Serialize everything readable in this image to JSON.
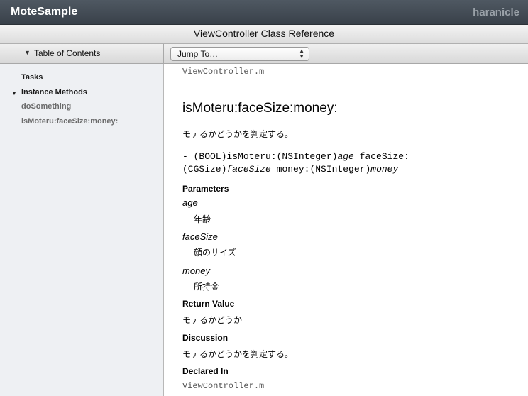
{
  "titlebar": {
    "app_name": "MoteSample",
    "company": "haranicle"
  },
  "classbar": {
    "title": "ViewController Class Reference"
  },
  "toolbar": {
    "toc_label": "Table of Contents",
    "jump_label": "Jump To…"
  },
  "sidebar": {
    "items": [
      {
        "label": "Tasks"
      },
      {
        "label": "Instance Methods"
      },
      {
        "label": "doSomething"
      },
      {
        "label": "isMoteru:faceSize:money:"
      }
    ]
  },
  "content": {
    "file_name": "ViewController.m",
    "method_title": "isMoteru:faceSize:money:",
    "abstract": "モテるかどうかを判定する。",
    "declaration": {
      "line1_a": "- (BOOL)isMoteru:(NSInteger)",
      "line1_arg": "age",
      "line1_b": " faceSize:",
      "line2_a": "(CGSize)",
      "line2_arg": "faceSize",
      "line2_b": " money:(NSInteger)",
      "line2_arg2": "money"
    },
    "parameters_heading": "Parameters",
    "parameters": [
      {
        "name": "age",
        "desc": "年齢"
      },
      {
        "name": "faceSize",
        "desc": "顔のサイズ"
      },
      {
        "name": "money",
        "desc": "所持金"
      }
    ],
    "return_heading": "Return Value",
    "return_text": "モテるかどうか",
    "discussion_heading": "Discussion",
    "discussion_text": "モテるかどうかを判定する。",
    "declared_heading": "Declared In",
    "declared_file": "ViewController.m"
  },
  "colors": {
    "titlebar": "#454d56",
    "sidebar_bg": "#eef0f3",
    "sidebar_heading": "#1a1a1a",
    "sidebar_link": "#6b6b6b"
  }
}
